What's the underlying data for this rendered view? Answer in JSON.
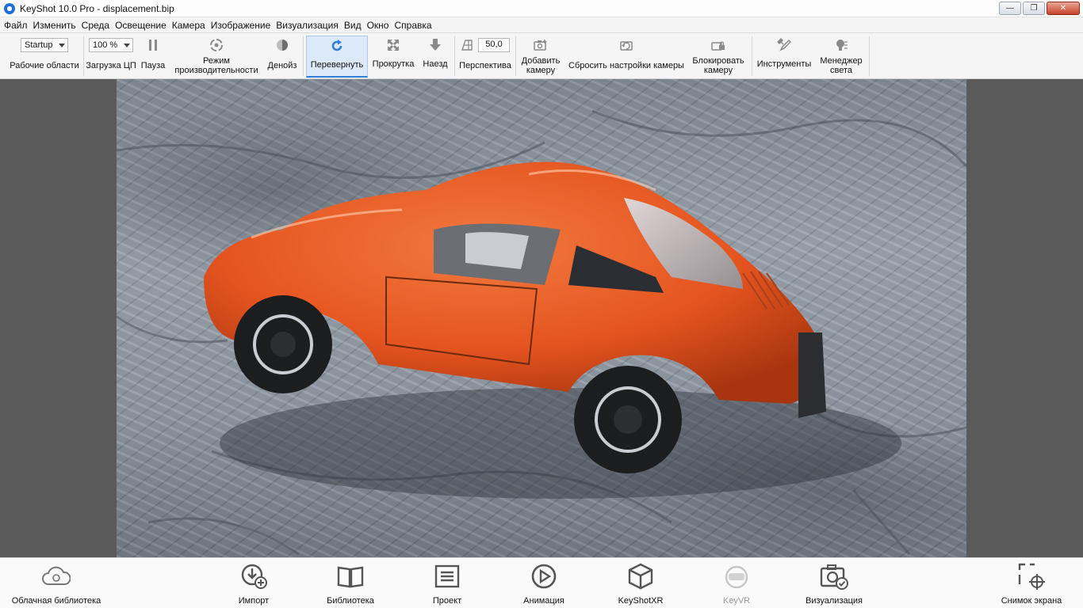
{
  "window": {
    "title": "KeyShot 10.0 Pro  - displacement.bip",
    "minimize_label": "—",
    "maximize_label": "❐",
    "close_label": "✕"
  },
  "menu": [
    "Файл",
    "Изменить",
    "Среда",
    "Освещение",
    "Камера",
    "Изображение",
    "Визуализация",
    "Вид",
    "Окно",
    "Справка"
  ],
  "ribbon": {
    "workspace_value": "Startup",
    "workspace_label": "Рабочие области",
    "cpu_value": "100 %",
    "cpu_label": "Загрузка ЦП",
    "pause_label": "Пауза",
    "performance_label_1": "Режим",
    "performance_label_2": "производительности",
    "denoise_label": "Денойз",
    "tumble_label": "Перевернуть",
    "pan_label": "Прокрутка",
    "dolly_label": "Наезд",
    "perspective_value": "50,0",
    "perspective_label": "Перспектива",
    "add_camera_label_1": "Добавить",
    "add_camera_label_2": "камеру",
    "reset_camera_label": "Сбросить настройки камеры",
    "lock_camera_label_1": "Блокировать",
    "lock_camera_label_2": "камеру",
    "tools_label": "Инструменты",
    "light_manager_label_1": "Менеджер",
    "light_manager_label_2": "света"
  },
  "dock": {
    "cloud_library": "Облачная библиотека",
    "import": "Импорт",
    "library": "Библиотека",
    "project": "Проект",
    "animation": "Анимация",
    "keyshotxr": "KeyShotXR",
    "keyvr": "KeyVR",
    "render": "Визуализация",
    "screenshot": "Снимок экрана"
  },
  "colors": {
    "accent": "#2f7fd6",
    "car_body": "#e5541f",
    "toolbar_bg": "#f5f5f5",
    "viewport_bg": "#5a5a5a"
  }
}
